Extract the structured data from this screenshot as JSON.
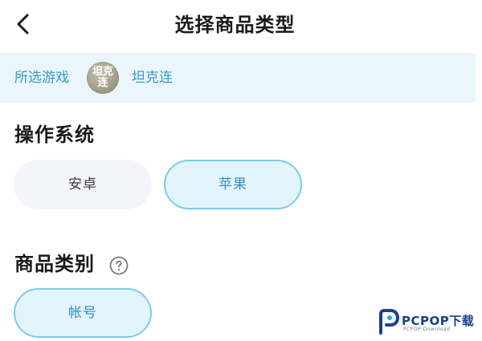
{
  "header": {
    "title": "选择商品类型"
  },
  "selected_game": {
    "label": "所选游戏",
    "avatar_line1": "坦克",
    "avatar_line2": "连",
    "name": "坦克连"
  },
  "os_section": {
    "title": "操作系统",
    "options": [
      {
        "label": "安卓",
        "selected": false
      },
      {
        "label": "苹果",
        "selected": true
      }
    ]
  },
  "category_section": {
    "title": "商品类别",
    "options": [
      {
        "label": "帐号",
        "selected": true
      }
    ]
  },
  "watermark": {
    "text": "PCPOP下载",
    "subtext": "PCPOP Download"
  },
  "colors": {
    "accent": "#3a98c7",
    "selected_border": "#7ccde8",
    "selected_fill": "#e3f4fb",
    "unselected_fill": "#f4f5f8",
    "game_bar_fill": "#eaf6fb"
  },
  "icons": {
    "back": "chevron-left-icon",
    "help": "question-circle-icon"
  }
}
